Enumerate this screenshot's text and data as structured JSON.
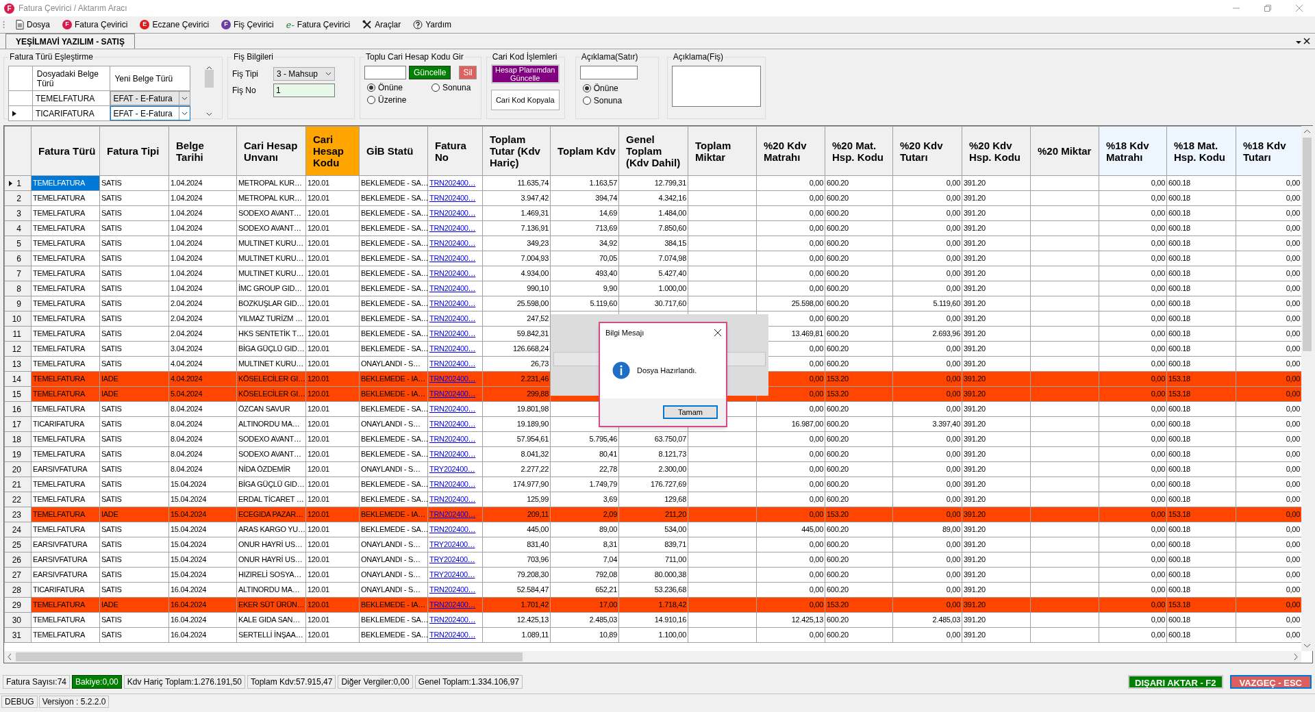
{
  "window": {
    "title": "Fatura Çevirici / Aktarım Aracı",
    "icon_letter": "F"
  },
  "menu": [
    {
      "label": "Dosya",
      "kind": "document"
    },
    {
      "label": "Fatura Çevirici",
      "kind": "badge",
      "icon_letter": "F",
      "color": "#d81b4c"
    },
    {
      "label": "Eczane Çevirici",
      "kind": "badge",
      "icon_letter": "E",
      "color": "#e01b1b"
    },
    {
      "label": "Fiş Çevirici",
      "kind": "badge",
      "icon_letter": "F",
      "color": "#6b3fa0"
    },
    {
      "label": "Fatura Çevirici",
      "kind": "script",
      "icon_letter": "e-"
    },
    {
      "label": "Araçlar",
      "kind": "tools"
    },
    {
      "label": "Yardım",
      "kind": "help"
    }
  ],
  "tab": {
    "label": "YEŞİLMAVİ YAZILIM - SATIŞ",
    "selected": true
  },
  "mapping": {
    "title": "Fatura Türü Eşleştirme",
    "columns": [
      "Dosyadaki Belge Türü",
      "Yeni Belge Türü"
    ],
    "rows": [
      {
        "source": "TEMELFATURA",
        "target": "EFAT - E-Fatura",
        "selected": false
      },
      {
        "source": "TICARIFATURA",
        "target": "EFAT - E-Fatura",
        "selected": true
      }
    ]
  },
  "fis": {
    "title": "Fiş Bilgileri",
    "type_label": "Fiş Tipi",
    "type_value": "3 - Mahsup",
    "no_label": "Fiş No",
    "no_value": "1"
  },
  "toplu": {
    "title": "Toplu Cari Hesap Kodu Gir",
    "update_button": "Güncelle",
    "delete_button": "Sil",
    "options": [
      {
        "label": "Önüne",
        "selected": true
      },
      {
        "label": "Sonuna",
        "selected": false
      },
      {
        "label": "Üzerine",
        "selected": false
      }
    ]
  },
  "cari_kod": {
    "title": "Cari Kod İşlemleri",
    "buttons": [
      "Hesap Planımdan Güncelle",
      "Cari Kod Kopyala"
    ]
  },
  "aciklama_satir": {
    "title": "Açıklama(Satır)",
    "options": [
      {
        "label": "Önüne",
        "selected": true
      },
      {
        "label": "Sonuna",
        "selected": false
      }
    ]
  },
  "aciklama_fis": {
    "title": "Açıklama(Fiş)"
  },
  "table": {
    "columns": [
      {
        "label": "Fatura Türü",
        "kind": "text"
      },
      {
        "label": "Fatura Tipi",
        "kind": "text"
      },
      {
        "label": "Belge Tarihi",
        "kind": "text"
      },
      {
        "label": "Cari Hesap Unvanı",
        "kind": "text"
      },
      {
        "label": "Cari Hesap Kodu",
        "kind": "text",
        "color": "#ffa500"
      },
      {
        "label": "GİB Statü",
        "kind": "text"
      },
      {
        "label": "Fatura No",
        "kind": "link"
      },
      {
        "label": "Toplam Tutar (Kdv Hariç)",
        "kind": "number"
      },
      {
        "label": "Toplam Kdv",
        "kind": "number"
      },
      {
        "label": "Genel Toplam (Kdv Dahil)",
        "kind": "number"
      },
      {
        "label": "Toplam Miktar",
        "kind": "number"
      },
      {
        "label": "%20 Kdv Matrahı",
        "kind": "number"
      },
      {
        "label": "%20 Mat. Hsp. Kodu",
        "kind": "text"
      },
      {
        "label": "%20 Kdv Tutarı",
        "kind": "number"
      },
      {
        "label": "%20 Kdv Hsp. Kodu",
        "kind": "text"
      },
      {
        "label": "%20 Miktar",
        "kind": "number"
      },
      {
        "label": "%18 Kdv Matrahı",
        "kind": "number",
        "color": "#eef6ff"
      },
      {
        "label": "%18 Mat. Hsp. Kodu",
        "kind": "text",
        "color": "#eef6ff"
      },
      {
        "label": "%18 Kdv Tutarı",
        "kind": "number",
        "color": "#eef6ff"
      }
    ],
    "rows": [
      {
        "no": "1",
        "selected": true,
        "highlighted": false,
        "cells": [
          "TEMELFATURA",
          "SATIS",
          "1.04.2024",
          "METROPAL KUR…",
          "120.01",
          "BEKLEMEDE - SA…",
          "TRN202400…",
          "11.635,74",
          "1.163,57",
          "12.799,31",
          null,
          "0,00",
          "600.20",
          "0,00",
          "391.20",
          null,
          "0,00",
          "600.18",
          "0,00"
        ]
      },
      {
        "no": "2",
        "selected": false,
        "highlighted": false,
        "cells": [
          "TEMELFATURA",
          "SATIS",
          "1.04.2024",
          "METROPAL KUR…",
          "120.01",
          "BEKLEMEDE - SA…",
          "TRN202400…",
          "3.947,42",
          "394,74",
          "4.342,16",
          null,
          "0,00",
          "600.20",
          "0,00",
          "391.20",
          null,
          "0,00",
          "600.18",
          "0,00"
        ]
      },
      {
        "no": "3",
        "selected": false,
        "highlighted": false,
        "cells": [
          "TEMELFATURA",
          "SATIS",
          "1.04.2024",
          "SODEXO AVANT…",
          "120.01",
          "BEKLEMEDE - SA…",
          "TRN202400…",
          "1.469,31",
          "14,69",
          "1.484,00",
          null,
          "0,00",
          "600.20",
          "0,00",
          "391.20",
          null,
          "0,00",
          "600.18",
          "0,00"
        ]
      },
      {
        "no": "4",
        "selected": false,
        "highlighted": false,
        "cells": [
          "TEMELFATURA",
          "SATIS",
          "1.04.2024",
          "SODEXO AVANT…",
          "120.01",
          "BEKLEMEDE - SA…",
          "TRN202400…",
          "7.136,91",
          "713,69",
          "7.850,60",
          null,
          "0,00",
          "600.20",
          "0,00",
          "391.20",
          null,
          "0,00",
          "600.18",
          "0,00"
        ]
      },
      {
        "no": "5",
        "selected": false,
        "highlighted": false,
        "cells": [
          "TEMELFATURA",
          "SATIS",
          "1.04.2024",
          "MULTINET KURU…",
          "120.01",
          "BEKLEMEDE - SA…",
          "TRN202400…",
          "349,23",
          "34,92",
          "384,15",
          null,
          "0,00",
          "600.20",
          "0,00",
          "391.20",
          null,
          "0,00",
          "600.18",
          "0,00"
        ]
      },
      {
        "no": "6",
        "selected": false,
        "highlighted": false,
        "cells": [
          "TEMELFATURA",
          "SATIS",
          "1.04.2024",
          "MULTINET KURU…",
          "120.01",
          "BEKLEMEDE - SA…",
          "TRN202400…",
          "7.004,93",
          "70,05",
          "7.074,98",
          null,
          "0,00",
          "600.20",
          "0,00",
          "391.20",
          null,
          "0,00",
          "600.18",
          "0,00"
        ]
      },
      {
        "no": "7",
        "selected": false,
        "highlighted": false,
        "cells": [
          "TEMELFATURA",
          "SATIS",
          "1.04.2024",
          "MULTINET KURU…",
          "120.01",
          "BEKLEMEDE - SA…",
          "TRN202400…",
          "4.934,00",
          "493,40",
          "5.427,40",
          null,
          "0,00",
          "600.20",
          "0,00",
          "391.20",
          null,
          "0,00",
          "600.18",
          "0,00"
        ]
      },
      {
        "no": "8",
        "selected": false,
        "highlighted": false,
        "cells": [
          "TEMELFATURA",
          "SATIS",
          "1.04.2024",
          "İMC GROUP GID…",
          "120.01",
          "BEKLEMEDE - SA…",
          "TRN202400…",
          "990,10",
          "9,90",
          "1.000,00",
          null,
          "0,00",
          "600.20",
          "0,00",
          "391.20",
          null,
          "0,00",
          "600.18",
          "0,00"
        ]
      },
      {
        "no": "9",
        "selected": false,
        "highlighted": false,
        "cells": [
          "TEMELFATURA",
          "SATIS",
          "2.04.2024",
          "BOZKUŞLAR GID…",
          "120.01",
          "BEKLEMEDE - SA…",
          "TRN202400…",
          "25.598,00",
          "5.119,60",
          "30.717,60",
          null,
          "25.598,00",
          "600.20",
          "5.119,60",
          "391.20",
          null,
          "0,00",
          "600.18",
          "0,00"
        ]
      },
      {
        "no": "10",
        "selected": false,
        "highlighted": false,
        "cells": [
          "TEMELFATURA",
          "SATIS",
          "2.04.2024",
          "YILMAZ TURİZM …",
          "120.01",
          "BEKLEMEDE - SA…",
          "TRN202400…",
          "247,52",
          null,
          null,
          null,
          "0,00",
          "600.20",
          "0,00",
          "391.20",
          null,
          "0,00",
          "600.18",
          "0,00"
        ]
      },
      {
        "no": "11",
        "selected": false,
        "highlighted": false,
        "cells": [
          "TEMELFATURA",
          "SATIS",
          "2.04.2024",
          "HKS SENTETİK T…",
          "120.01",
          "BEKLEMEDE - SA…",
          "TRN202400…",
          "59.842,31",
          null,
          null,
          null,
          "13.469,81",
          "600.20",
          "2.693,96",
          "391.20",
          null,
          "0,00",
          "600.18",
          "0,00"
        ]
      },
      {
        "no": "12",
        "selected": false,
        "highlighted": false,
        "cells": [
          "TEMELFATURA",
          "SATIS",
          "3.04.2024",
          "BİGA GÜÇLÜ GID…",
          "120.01",
          "BEKLEMEDE - SA…",
          "TRN202400…",
          "126.668,24",
          null,
          null,
          null,
          "0,00",
          "600.20",
          "0,00",
          "391.20",
          null,
          "0,00",
          "600.18",
          "0,00"
        ]
      },
      {
        "no": "13",
        "selected": false,
        "highlighted": false,
        "cells": [
          "TEMELFATURA",
          "SATIS",
          "4.04.2024",
          "MULTINET KURU…",
          "120.01",
          "ONAYLANDI - S…",
          "TRN202400…",
          "26,73",
          null,
          null,
          null,
          "0,00",
          "600.20",
          "0,00",
          "391.20",
          null,
          "0,00",
          "600.18",
          "0,00"
        ]
      },
      {
        "no": "14",
        "selected": false,
        "highlighted": true,
        "cells": [
          "TEMELFATURA",
          "IADE",
          "4.04.2024",
          "KÖSELECİLER GI…",
          "120.01",
          "BEKLEMEDE - IA…",
          "TRN202400…",
          "2.231,46",
          null,
          null,
          null,
          "0,00",
          "153.20",
          "0,00",
          "391.20",
          null,
          "0,00",
          "153.18",
          "0,00"
        ]
      },
      {
        "no": "15",
        "selected": false,
        "highlighted": true,
        "cells": [
          "TEMELFATURA",
          "IADE",
          "5.04.2024",
          "KÖSELECİLER GI…",
          "120.01",
          "BEKLEMEDE - IA…",
          "TRN202400…",
          "299,88",
          null,
          null,
          null,
          "0,00",
          "153.20",
          "0,00",
          "391.20",
          null,
          "0,00",
          "153.18",
          "0,00"
        ]
      },
      {
        "no": "16",
        "selected": false,
        "highlighted": false,
        "cells": [
          "TEMELFATURA",
          "SATIS",
          "8.04.2024",
          "ÖZCAN SAVUR",
          "120.01",
          "BEKLEMEDE - SA…",
          "TRN202400…",
          "19.801,98",
          null,
          null,
          null,
          "0,00",
          "600.20",
          "0,00",
          "391.20",
          null,
          "0,00",
          "600.18",
          "0,00"
        ]
      },
      {
        "no": "17",
        "selected": false,
        "highlighted": false,
        "cells": [
          "TICARIFATURA",
          "SATIS",
          "8.04.2024",
          "ALTINORDU MA…",
          "120.01",
          "ONAYLANDI - S…",
          "TRN202400…",
          "19.189,90",
          null,
          null,
          null,
          "16.987,00",
          "600.20",
          "3.397,40",
          "391.20",
          null,
          "0,00",
          "600.18",
          "0,00"
        ]
      },
      {
        "no": "18",
        "selected": false,
        "highlighted": false,
        "cells": [
          "TEMELFATURA",
          "SATIS",
          "8.04.2024",
          "SODEXO AVANT…",
          "120.01",
          "BEKLEMEDE - SA…",
          "TRN202400…",
          "57.954,61",
          "5.795,46",
          "63.750,07",
          null,
          "0,00",
          "600.20",
          "0,00",
          "391.20",
          null,
          "0,00",
          "600.18",
          "0,00"
        ]
      },
      {
        "no": "19",
        "selected": false,
        "highlighted": false,
        "cells": [
          "TEMELFATURA",
          "SATIS",
          "8.04.2024",
          "SODEXO AVANT…",
          "120.01",
          "BEKLEMEDE - SA…",
          "TRN202400…",
          "8.041,32",
          "80,41",
          "8.121,73",
          null,
          "0,00",
          "600.20",
          "0,00",
          "391.20",
          null,
          "0,00",
          "600.18",
          "0,00"
        ]
      },
      {
        "no": "20",
        "selected": false,
        "highlighted": false,
        "cells": [
          "EARSIVFATURA",
          "SATIS",
          "8.04.2024",
          "NİDA ÖZDEMİR",
          "120.01",
          "ONAYLANDI - S…",
          "TRY202400…",
          "2.277,22",
          "22,78",
          "2.300,00",
          null,
          "0,00",
          "600.20",
          "0,00",
          "391.20",
          null,
          "0,00",
          "600.18",
          "0,00"
        ]
      },
      {
        "no": "21",
        "selected": false,
        "highlighted": false,
        "cells": [
          "TEMELFATURA",
          "SATIS",
          "15.04.2024",
          "BİGA GÜÇLÜ GID…",
          "120.01",
          "BEKLEMEDE - SA…",
          "TRN202400…",
          "174.977,90",
          "1.749,79",
          "176.727,69",
          null,
          "0,00",
          "600.20",
          "0,00",
          "391.20",
          null,
          "0,00",
          "600.18",
          "0,00"
        ]
      },
      {
        "no": "22",
        "selected": false,
        "highlighted": false,
        "cells": [
          "TEMELFATURA",
          "SATIS",
          "15.04.2024",
          "ERDAL TİCARET …",
          "120.01",
          "BEKLEMEDE - SA…",
          "TRN202400…",
          "125,99",
          "3,69",
          "129,68",
          null,
          "0,00",
          "600.20",
          "0,00",
          "391.20",
          null,
          "0,00",
          "600.18",
          "0,00"
        ]
      },
      {
        "no": "23",
        "selected": false,
        "highlighted": true,
        "cells": [
          "TEMELFATURA",
          "IADE",
          "15.04.2024",
          "ECEGIDA PAZAR…",
          "120.01",
          "BEKLEMEDE - IA…",
          "TRN202400…",
          "209,11",
          "2,09",
          "211,20",
          null,
          "0,00",
          "153.20",
          "0,00",
          "391.20",
          null,
          "0,00",
          "153.18",
          "0,00"
        ]
      },
      {
        "no": "24",
        "selected": false,
        "highlighted": false,
        "cells": [
          "TEMELFATURA",
          "SATIS",
          "15.04.2024",
          "ARAS KARGO YU…",
          "120.01",
          "BEKLEMEDE - SA…",
          "TRN202400…",
          "445,00",
          "89,00",
          "534,00",
          null,
          "445,00",
          "600.20",
          "89,00",
          "391.20",
          null,
          "0,00",
          "600.18",
          "0,00"
        ]
      },
      {
        "no": "25",
        "selected": false,
        "highlighted": false,
        "cells": [
          "EARSIVFATURA",
          "SATIS",
          "15.04.2024",
          "ONUR HAYRİ US…",
          "120.01",
          "ONAYLANDI - S…",
          "TRY202400…",
          "831,40",
          "8,31",
          "839,71",
          null,
          "0,00",
          "600.20",
          "0,00",
          "391.20",
          null,
          "0,00",
          "600.18",
          "0,00"
        ]
      },
      {
        "no": "26",
        "selected": false,
        "highlighted": false,
        "cells": [
          "EARSIVFATURA",
          "SATIS",
          "15.04.2024",
          "ONUR HAYRİ US…",
          "120.01",
          "ONAYLANDI - S…",
          "TRY202400…",
          "703,96",
          "7,04",
          "711,00",
          null,
          "0,00",
          "600.20",
          "0,00",
          "391.20",
          null,
          "0,00",
          "600.18",
          "0,00"
        ]
      },
      {
        "no": "27",
        "selected": false,
        "highlighted": false,
        "cells": [
          "EARSIVFATURA",
          "SATIS",
          "15.04.2024",
          "HIZIRELİ SOSYA…",
          "120.01",
          "ONAYLANDI - S…",
          "TRY202400…",
          "79.208,30",
          "792,08",
          "80.000,38",
          null,
          "0,00",
          "600.20",
          "0,00",
          "391.20",
          null,
          "0,00",
          "600.18",
          "0,00"
        ]
      },
      {
        "no": "28",
        "selected": false,
        "highlighted": false,
        "cells": [
          "TICARIFATURA",
          "SATIS",
          "16.04.2024",
          "ALTINORDU MA…",
          "120.01",
          "ONAYLANDI - S…",
          "TRN202400…",
          "52.584,47",
          "652,21",
          "53.236,68",
          null,
          "0,00",
          "600.20",
          "0,00",
          "391.20",
          null,
          "0,00",
          "600.18",
          "0,00"
        ]
      },
      {
        "no": "29",
        "selected": false,
        "highlighted": true,
        "cells": [
          "TEMELFATURA",
          "IADE",
          "16.04.2024",
          "EKER SÜT ÜRÜN…",
          "120.01",
          "BEKLEMEDE - IA…",
          "TRN202400…",
          "1.701,42",
          "17,00",
          "1.718,42",
          null,
          "0,00",
          "153.20",
          "0,00",
          "391.20",
          null,
          "0,00",
          "153.18",
          "0,00"
        ]
      },
      {
        "no": "30",
        "selected": false,
        "highlighted": false,
        "cells": [
          "TEMELFATURA",
          "SATIS",
          "16.04.2024",
          "KALE GIDA SAN…",
          "120.01",
          "BEKLEMEDE - SA…",
          "TRN202400…",
          "12.425,13",
          "2.485,03",
          "14.910,16",
          null,
          "12.425,13",
          "600.20",
          "2.485,03",
          "391.20",
          null,
          "0,00",
          "600.18",
          "0,00"
        ]
      },
      {
        "no": "31",
        "selected": false,
        "highlighted": false,
        "cells": [
          "TEMELFATURA",
          "SATIS",
          "16.04.2024",
          "SERTELLİ İNŞAA…",
          "120.01",
          "BEKLEMEDE - SA…",
          "TRN202400…",
          "1.089,11",
          "10,89",
          "1.100,00",
          null,
          "0,00",
          "600.20",
          "0,00",
          "391.20",
          null,
          "0,00",
          "600.18",
          "0,00"
        ]
      }
    ]
  },
  "dialog": {
    "title": "Bilgi Mesajı",
    "message": "Dosya Hazırlandı.",
    "button": "Tamam"
  },
  "status": [
    {
      "label": "Fatura Sayısı:74",
      "highlighted": false
    },
    {
      "label": "Bakiye:0,00",
      "highlighted": true
    },
    {
      "label": "Kdv Hariç Toplam:1.276.191,50",
      "highlighted": false
    },
    {
      "label": "Toplam Kdv:57.915,47",
      "highlighted": false
    },
    {
      "label": "Diğer Vergiler:0,00",
      "highlighted": false
    },
    {
      "label": "Genel Toplam:1.334.106,97",
      "highlighted": false
    }
  ],
  "actions": [
    {
      "label": "DIŞARI AKTAR - F2",
      "kind": "export"
    },
    {
      "label": "VAZGEÇ - ESC",
      "kind": "cancel"
    }
  ],
  "footer": [
    "DEBUG",
    "Versiyon : 5.2.2.0"
  ]
}
